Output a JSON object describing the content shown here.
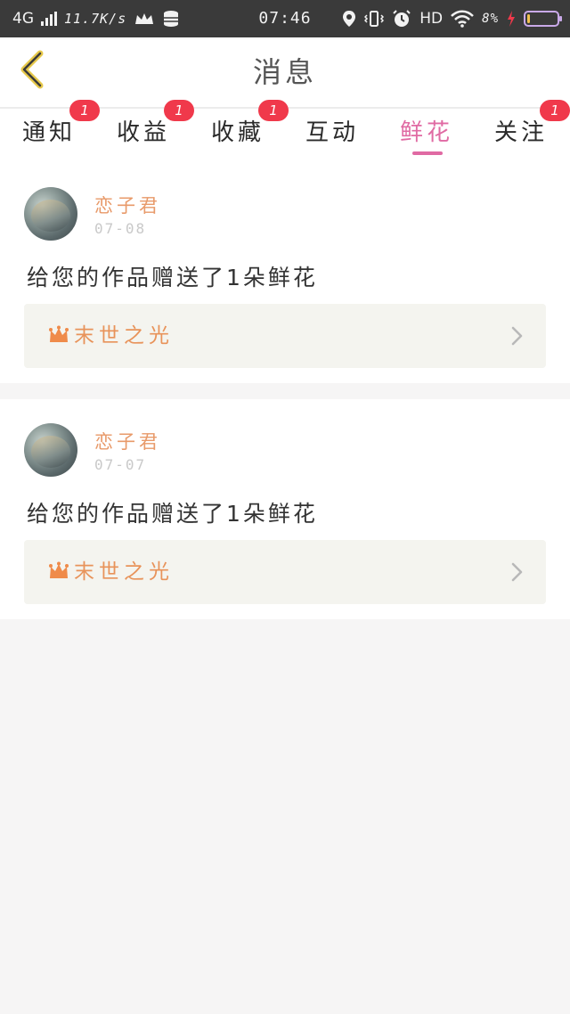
{
  "status_bar": {
    "network": "4G",
    "speed": "11.7K/s",
    "time": "07:46",
    "hd": "HD",
    "battery": "8%",
    "battery_level": 0.08
  },
  "header": {
    "title": "消息"
  },
  "tabs": [
    {
      "label": "通知",
      "badge": "1"
    },
    {
      "label": "收益",
      "badge": "1"
    },
    {
      "label": "收藏",
      "badge": "1"
    },
    {
      "label": "互动",
      "badge": ""
    },
    {
      "label": "鲜花",
      "badge": "",
      "active": true
    },
    {
      "label": "关注",
      "badge": "1"
    }
  ],
  "messages": [
    {
      "user": "恋子君",
      "date": "07-08",
      "text": "给您的作品赠送了1朵鲜花",
      "work_title": "末世之光"
    },
    {
      "user": "恋子君",
      "date": "07-07",
      "text": "给您的作品赠送了1朵鲜花",
      "work_title": "末世之光"
    }
  ],
  "colors": {
    "accent": "#e06aa3",
    "badge": "#f0394b",
    "username": "#e89a6a",
    "work": "#e8935a"
  }
}
